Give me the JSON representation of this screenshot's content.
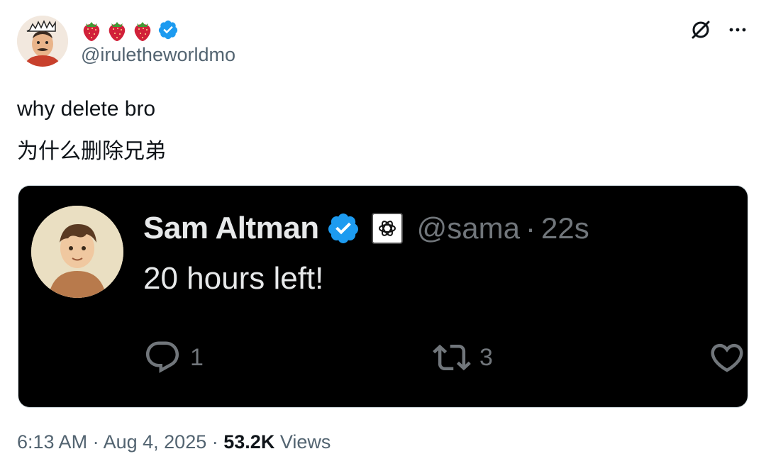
{
  "author": {
    "handle": "@iruletheworldmo",
    "emoji_badges": [
      "strawberry",
      "strawberry",
      "strawberry"
    ],
    "verified": true
  },
  "tweet": {
    "lines": [
      "why delete bro",
      "为什么删除兄弟"
    ]
  },
  "quoted": {
    "name": "Sam Altman",
    "handle": "@sama",
    "separator": "·",
    "time": "22s",
    "text": "20 hours left!",
    "reply_count": "1",
    "retweet_count": "3"
  },
  "meta": {
    "time": "6:13 AM",
    "sep1": "·",
    "date": "Aug 4, 2025",
    "sep2": "·",
    "views_count": "53.2K",
    "views_label": "Views"
  },
  "colors": {
    "verified_blue": "#1d9bf0",
    "muted_text": "#536471",
    "card_bg": "#000000",
    "strawberry": "#d1213a"
  }
}
